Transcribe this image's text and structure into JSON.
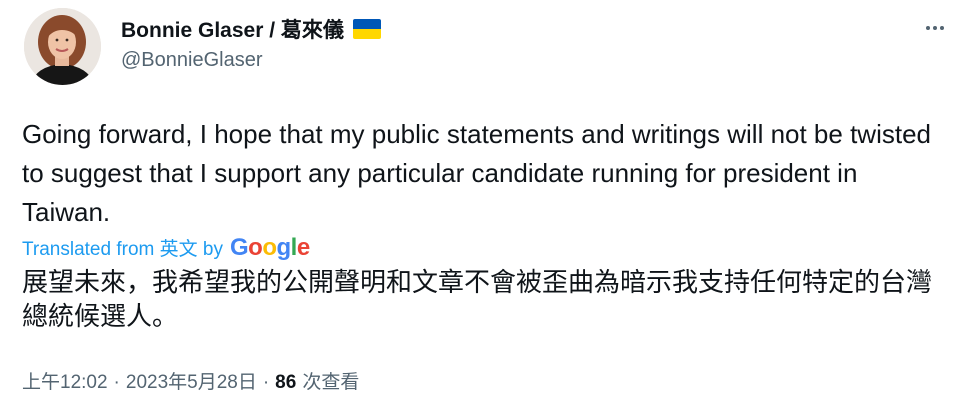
{
  "author": {
    "display_name": "Bonnie Glaser / 葛來儀",
    "handle": "@BonnieGlaser",
    "flag_icon": "ukraine-flag-icon",
    "flag_colors": [
      "#0057b7",
      "#ffd700"
    ]
  },
  "tweet": {
    "text": "Going forward, I hope that my public statements and writings will not be twisted to suggest that I support any particular candidate running for president in Taiwan.",
    "translation": {
      "attribution": "Translated from 英文 by",
      "provider": "Google",
      "text": "展望未來，我希望我的公開聲明和文章不會被歪曲為暗示我支持任何特定的台灣總統候選人。"
    },
    "time": "上午12:02",
    "date": "2023年5月28日",
    "views_count": "86",
    "views_label": "次查看"
  },
  "icons": {
    "more": "more-options-icon"
  },
  "colors": {
    "link": "#1d9bf0",
    "secondary_text": "#536471",
    "primary_text": "#0f1419"
  }
}
